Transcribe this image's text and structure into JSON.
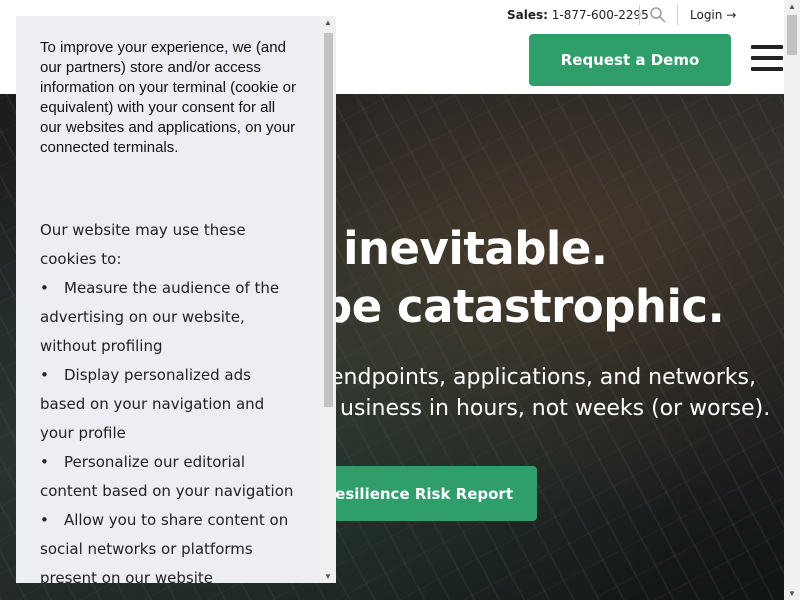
{
  "topbar": {
    "sales_label": "Sales:",
    "sales_phone": "1-877-600-2295",
    "search_icon": "search-icon",
    "login_label": "Login →"
  },
  "header": {
    "demo_button": "Request a Demo",
    "menu_icon": "hamburger-menu-icon"
  },
  "hero": {
    "headline_line1": "n is inevitable.",
    "headline_line2": "be catastrophic.",
    "sub_line1": "endpoints, applications, and networks,",
    "sub_line2": "usiness in hours, not weeks (or worse).",
    "cta_label": "d Resilience Risk Report"
  },
  "cookie": {
    "intro": "To improve your experience, we (and our partners) store and/or access information on your terminal (cookie or equivalent) with your consent for all our websites and applications, on your connected terminals.",
    "uses_heading": "Our website may use these cookies to:",
    "uses": [
      "Measure the audience of the advertising on our website, without profiling",
      "Display personalized ads based on your navigation and your profile",
      "Personalize our editorial content based on your navigation",
      "Allow you to share content on social networks or platforms present on our website"
    ]
  },
  "colors": {
    "accent_green": "#2f9e6b",
    "cookie_bg": "#eceef3"
  }
}
